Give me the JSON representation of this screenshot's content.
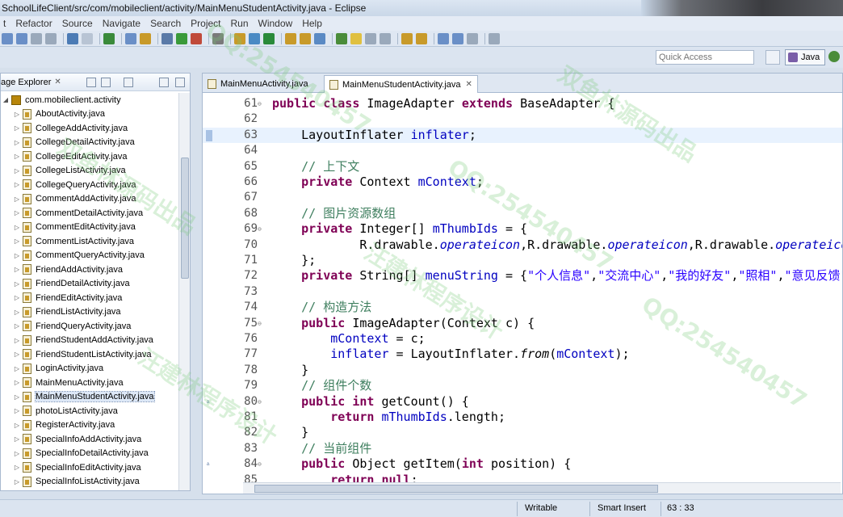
{
  "window": {
    "title": "SchoolLifeClient/src/com/mobileclient/activity/MainMenuStudentActivity.java - Eclipse"
  },
  "menu": [
    "t",
    "Refactor",
    "Source",
    "Navigate",
    "Search",
    "Project",
    "Run",
    "Window",
    "Help"
  ],
  "toolbar": {
    "quick_access_placeholder": "Quick Access",
    "perspective": "Java"
  },
  "package_explorer": {
    "title": "age Explorer",
    "package": "com.mobileclient.activity",
    "files": [
      "AboutActivity.java",
      "CollegeAddActivity.java",
      "CollegeDetailActivity.java",
      "CollegeEditActivity.java",
      "CollegeListActivity.java",
      "CollegeQueryActivity.java",
      "CommentAddActivity.java",
      "CommentDetailActivity.java",
      "CommentEditActivity.java",
      "CommentListActivity.java",
      "CommentQueryActivity.java",
      "FriendAddActivity.java",
      "FriendDetailActivity.java",
      "FriendEditActivity.java",
      "FriendListActivity.java",
      "FriendQueryActivity.java",
      "FriendStudentAddActivity.java",
      "FriendStudentListActivity.java",
      "LoginActivity.java",
      "MainMenuActivity.java",
      "MainMenuStudentActivity.java",
      "photoListActivity.java",
      "RegisterActivity.java",
      "SpecialInfoAddActivity.java",
      "SpecialInfoDetailActivity.java",
      "SpecialInfoEditActivity.java",
      "SpecialInfoListActivity.java"
    ],
    "selected": "MainMenuStudentActivity.java"
  },
  "editor": {
    "tabs": [
      {
        "label": "MainMenuActivity.java",
        "active": false
      },
      {
        "label": "MainMenuStudentActivity.java",
        "active": true
      }
    ],
    "lines": [
      {
        "n": "61",
        "fold": "⊖",
        "segs": [
          [
            "kw",
            "public class "
          ],
          [
            "",
            "ImageAdapter "
          ],
          [
            "kw",
            "extends "
          ],
          [
            "",
            "BaseAdapter {"
          ]
        ]
      },
      {
        "n": "62",
        "segs": []
      },
      {
        "n": "63",
        "current": true,
        "segs": [
          [
            "",
            "    LayoutInflater "
          ],
          [
            "fld",
            "inflater"
          ],
          [
            "",
            ";"
          ]
        ]
      },
      {
        "n": "64",
        "segs": []
      },
      {
        "n": "65",
        "segs": [
          [
            "cm",
            "    // 上下文"
          ]
        ]
      },
      {
        "n": "66",
        "segs": [
          [
            "kw",
            "    private "
          ],
          [
            "",
            "Context "
          ],
          [
            "fld",
            "mContext"
          ],
          [
            "",
            ";"
          ]
        ]
      },
      {
        "n": "67",
        "segs": []
      },
      {
        "n": "68",
        "segs": [
          [
            "cm",
            "    // 图片资源数组"
          ]
        ]
      },
      {
        "n": "69",
        "fold": "⊖",
        "segs": [
          [
            "kw",
            "    private "
          ],
          [
            "",
            "Integer[] "
          ],
          [
            "fld",
            "mThumbIds"
          ],
          [
            "",
            " = {"
          ]
        ]
      },
      {
        "n": "70",
        "segs": [
          [
            "",
            "            R.drawable."
          ],
          [
            "itfld",
            "operateicon"
          ],
          [
            "",
            ",R.drawable."
          ],
          [
            "itfld",
            "operateicon"
          ],
          [
            "",
            ",R.drawable."
          ],
          [
            "itfld",
            "operateicon"
          ],
          [
            "",
            ","
          ]
        ]
      },
      {
        "n": "71",
        "segs": [
          [
            "",
            "    };"
          ]
        ]
      },
      {
        "n": "72",
        "segs": [
          [
            "kw",
            "    private "
          ],
          [
            "",
            "String[] "
          ],
          [
            "fld",
            "menuString"
          ],
          [
            "",
            " = {"
          ],
          [
            "str",
            "\"个人信息\""
          ],
          [
            "",
            ","
          ],
          [
            "str",
            "\"交流中心\""
          ],
          [
            "",
            ","
          ],
          [
            "str",
            "\"我的好友\""
          ],
          [
            "",
            ","
          ],
          [
            "str",
            "\"照相\""
          ],
          [
            "",
            ","
          ],
          [
            "str",
            "\"意见反馈\""
          ],
          [
            "",
            "};"
          ]
        ]
      },
      {
        "n": "73",
        "segs": []
      },
      {
        "n": "74",
        "segs": [
          [
            "cm",
            "    // 构造方法"
          ]
        ]
      },
      {
        "n": "75",
        "fold": "⊖",
        "segs": [
          [
            "kw",
            "    public "
          ],
          [
            "",
            "ImageAdapter(Context c) {"
          ]
        ]
      },
      {
        "n": "76",
        "segs": [
          [
            "fld",
            "        mContext"
          ],
          [
            "",
            " = c;"
          ]
        ]
      },
      {
        "n": "77",
        "segs": [
          [
            "fld",
            "        inflater"
          ],
          [
            "",
            " = LayoutInflater."
          ],
          [
            "it",
            "from"
          ],
          [
            "",
            "("
          ],
          [
            "fld",
            "mContext"
          ],
          [
            "",
            ");"
          ]
        ]
      },
      {
        "n": "78",
        "segs": [
          [
            "",
            "    }"
          ]
        ]
      },
      {
        "n": "79",
        "segs": [
          [
            "cm",
            "    // 组件个数"
          ]
        ]
      },
      {
        "n": "80",
        "fold": "⊖",
        "override": "▵",
        "segs": [
          [
            "kw",
            "    public int "
          ],
          [
            "",
            "getCount() {"
          ]
        ]
      },
      {
        "n": "81",
        "segs": [
          [
            "kw",
            "        return "
          ],
          [
            "fld",
            "mThumbIds"
          ],
          [
            "",
            ".length;"
          ]
        ]
      },
      {
        "n": "82",
        "segs": [
          [
            "",
            "    }"
          ]
        ]
      },
      {
        "n": "83",
        "segs": [
          [
            "cm",
            "    // 当前组件"
          ]
        ]
      },
      {
        "n": "84",
        "fold": "⊖",
        "override": "▵",
        "segs": [
          [
            "kw",
            "    public "
          ],
          [
            "",
            "Object getItem("
          ],
          [
            "kw",
            "int "
          ],
          [
            "",
            "position) {"
          ]
        ]
      },
      {
        "n": "85",
        "segs": [
          [
            "kw",
            "        return null"
          ],
          [
            "",
            ";"
          ]
        ]
      }
    ]
  },
  "statusbar": {
    "writable": "Writable",
    "insert_mode": "Smart Insert",
    "position": "63 : 33"
  },
  "watermark": {
    "text1": "QQ:254540457",
    "text2": "双鱼林源码出品",
    "text3": "汪建林程序设计"
  },
  "colors": {
    "keyword": "#7f0055",
    "field": "#0000c0",
    "comment": "#3f7f5f",
    "string": "#2a00ff"
  }
}
